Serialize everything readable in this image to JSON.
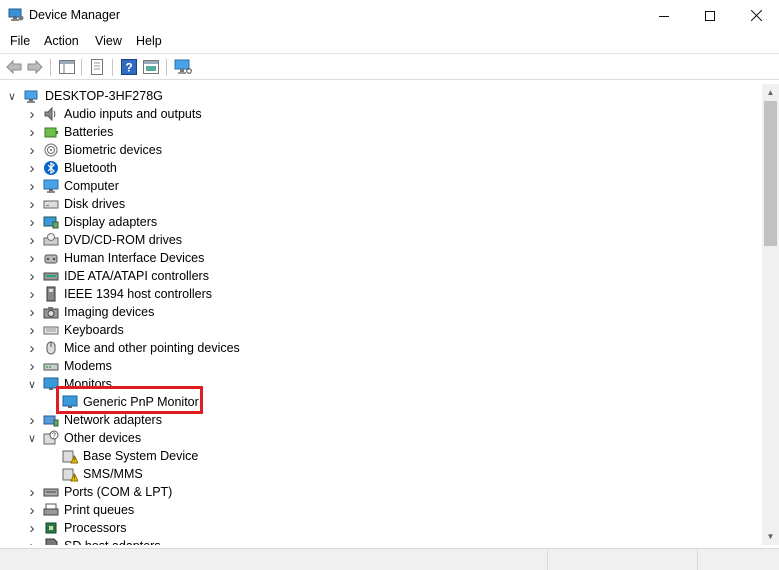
{
  "window": {
    "title": "Device Manager"
  },
  "menu": [
    "File",
    "Action",
    "View",
    "Help"
  ],
  "tree": {
    "root": "DESKTOP-3HF278G",
    "items": [
      {
        "label": "Audio inputs and outputs",
        "icon": "speaker-icon",
        "expanded": false
      },
      {
        "label": "Batteries",
        "icon": "battery-icon",
        "expanded": false
      },
      {
        "label": "Biometric devices",
        "icon": "fingerprint-icon",
        "expanded": false
      },
      {
        "label": "Bluetooth",
        "icon": "bluetooth-icon",
        "expanded": false
      },
      {
        "label": "Computer",
        "icon": "computer-icon",
        "expanded": false
      },
      {
        "label": "Disk drives",
        "icon": "disk-drive-icon",
        "expanded": false
      },
      {
        "label": "Display adapters",
        "icon": "display-adapter-icon",
        "expanded": false
      },
      {
        "label": "DVD/CD-ROM drives",
        "icon": "dvd-drive-icon",
        "expanded": false
      },
      {
        "label": "Human Interface Devices",
        "icon": "hid-icon",
        "expanded": false
      },
      {
        "label": "IDE ATA/ATAPI controllers",
        "icon": "ide-controller-icon",
        "expanded": false
      },
      {
        "label": "IEEE 1394 host controllers",
        "icon": "ieee1394-icon",
        "expanded": false
      },
      {
        "label": "Imaging devices",
        "icon": "camera-icon",
        "expanded": false
      },
      {
        "label": "Keyboards",
        "icon": "keyboard-icon",
        "expanded": false
      },
      {
        "label": "Mice and other pointing devices",
        "icon": "mouse-icon",
        "expanded": false
      },
      {
        "label": "Modems",
        "icon": "modem-icon",
        "expanded": false
      },
      {
        "label": "Monitors",
        "icon": "monitor-icon",
        "expanded": true,
        "children": [
          {
            "label": "Generic PnP Monitor",
            "icon": "monitor-icon",
            "selected": true
          }
        ]
      },
      {
        "label": "Network adapters",
        "icon": "network-adapter-icon",
        "expanded": false
      },
      {
        "label": "Other devices",
        "icon": "unknown-device-icon",
        "expanded": true,
        "children": [
          {
            "label": "Base System Device",
            "icon": "warning-device-icon"
          },
          {
            "label": "SMS/MMS",
            "icon": "warning-device-icon"
          }
        ]
      },
      {
        "label": "Ports (COM & LPT)",
        "icon": "port-icon",
        "expanded": false
      },
      {
        "label": "Print queues",
        "icon": "printer-icon",
        "expanded": false
      },
      {
        "label": "Processors",
        "icon": "processor-icon",
        "expanded": false
      },
      {
        "label": "SD host adapters",
        "icon": "sd-card-icon",
        "expanded": false
      }
    ]
  },
  "colors": {
    "highlight": "#e11b22",
    "accent": "#0078d7"
  }
}
